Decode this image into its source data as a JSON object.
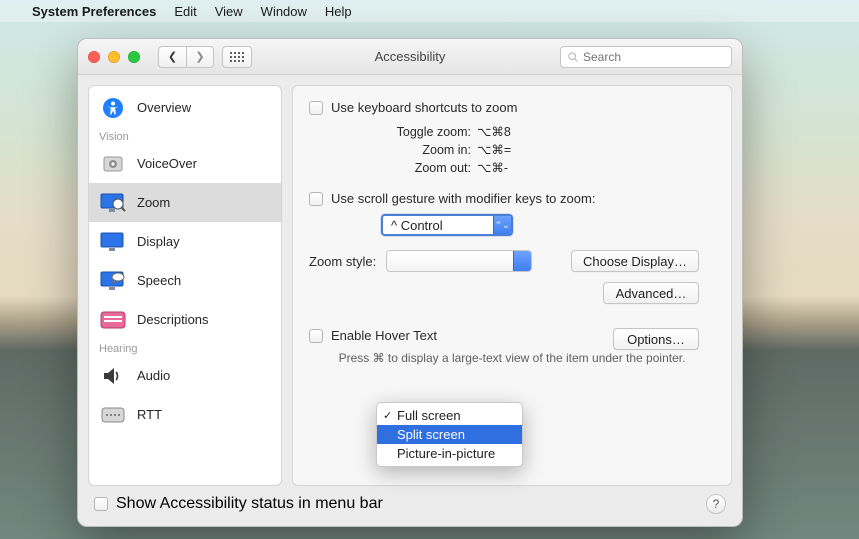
{
  "menubar": {
    "app": "System Preferences",
    "items": [
      "Edit",
      "View",
      "Window",
      "Help"
    ]
  },
  "window": {
    "title": "Accessibility",
    "search_placeholder": "Search"
  },
  "sidebar": {
    "overview": "Overview",
    "section_vision": "Vision",
    "voiceover": "VoiceOver",
    "zoom": "Zoom",
    "display": "Display",
    "speech": "Speech",
    "descriptions": "Descriptions",
    "section_hearing": "Hearing",
    "audio": "Audio",
    "rtt": "RTT"
  },
  "zoom": {
    "use_kb": "Use keyboard shortcuts to zoom",
    "toggle_label": "Toggle zoom:",
    "toggle_keys": "⌥⌘8",
    "in_label": "Zoom in:",
    "in_keys": "⌥⌘=",
    "out_label": "Zoom out:",
    "out_keys": "⌥⌘-",
    "use_scroll": "Use scroll gesture with modifier keys to zoom:",
    "modifier_value": "^ Control",
    "style_label": "Zoom style:",
    "choose_display": "Choose Display…",
    "advanced": "Advanced…",
    "hover_label": "Enable Hover Text",
    "options": "Options…",
    "hover_hint": "Press ⌘ to display a large-text view of the item under the pointer.",
    "style_options": {
      "full": "Full screen",
      "split": "Split screen",
      "pip": "Picture-in-picture"
    }
  },
  "footer": {
    "show_status": "Show Accessibility status in menu bar"
  }
}
